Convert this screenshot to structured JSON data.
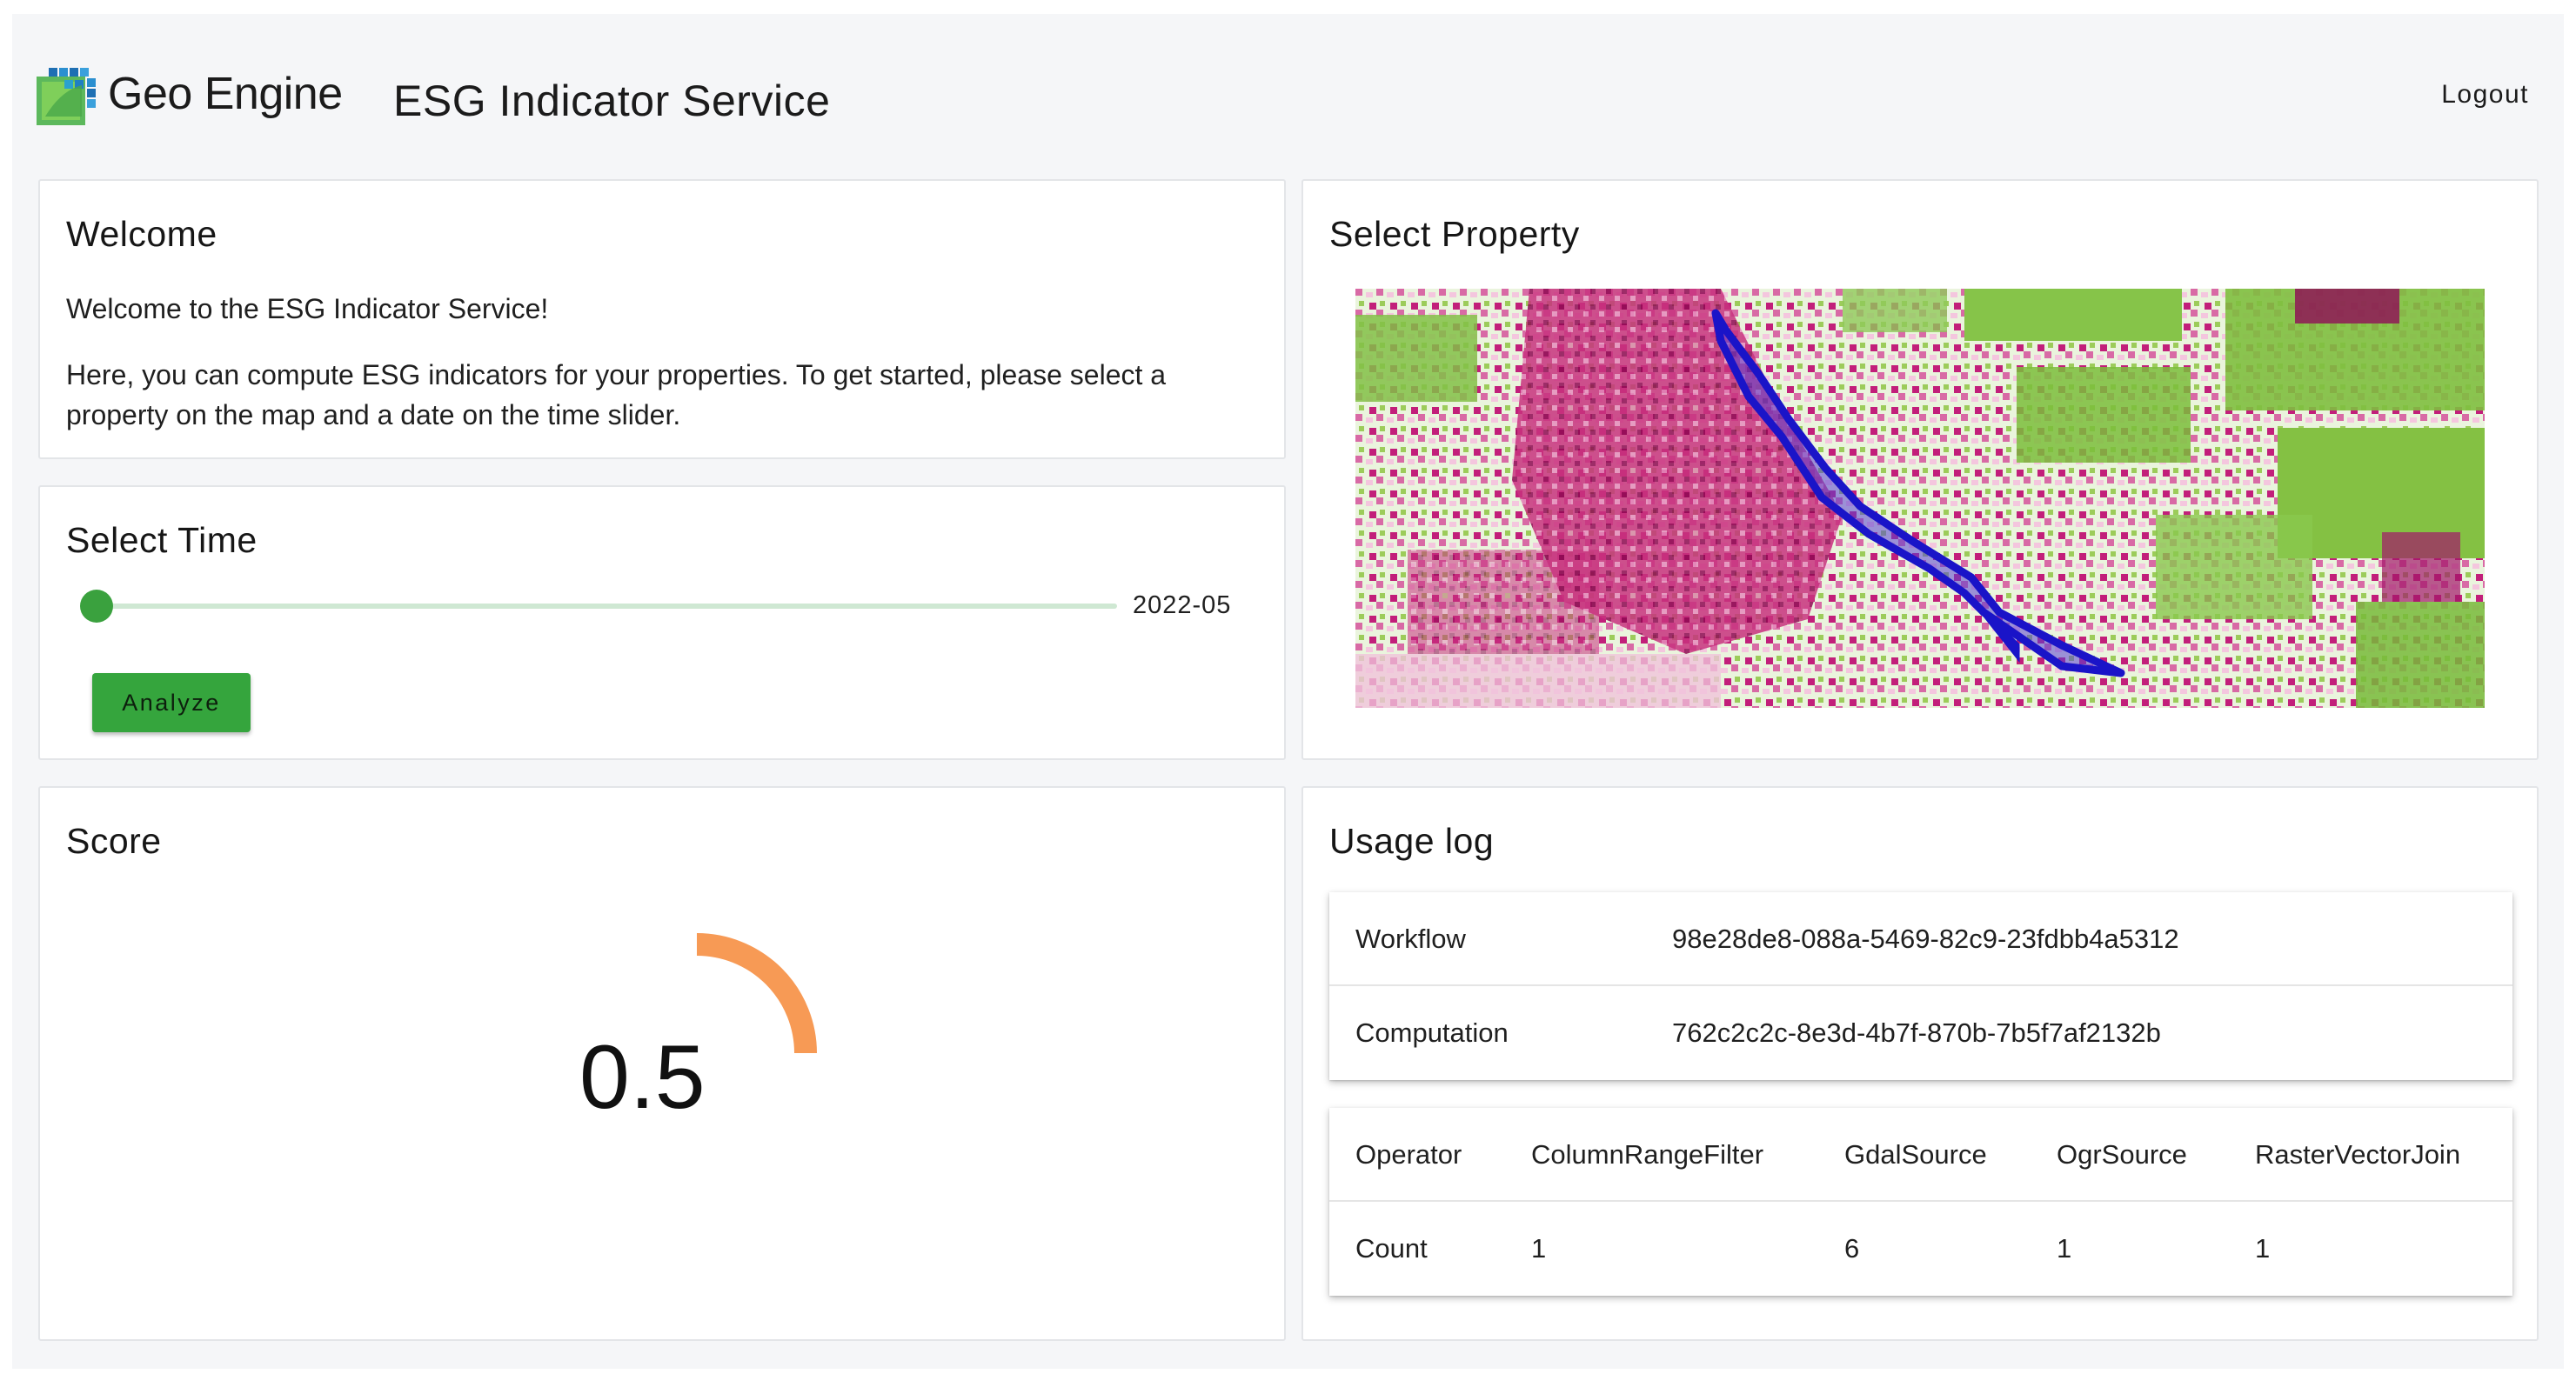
{
  "header": {
    "brand": "Geo Engine",
    "app_title": "ESG Indicator Service",
    "logout_label": "Logout",
    "logo_icon": "geo-engine-logo-icon"
  },
  "welcome": {
    "title": "Welcome",
    "line1": "Welcome to the ESG Indicator Service!",
    "line2a": "Here, you can compute ESG indicators for your properties. To get started, please select a",
    "line2b": "property on the map and a date on the time slider."
  },
  "select_time": {
    "title": "Select Time",
    "slider_value": "2022-05",
    "slider_position": 0,
    "analyze_label": "Analyze"
  },
  "score": {
    "title": "Score",
    "value": "0.5",
    "gauge_fraction": 0.5,
    "gauge_color": "#f79a55"
  },
  "select_property": {
    "title": "Select Property",
    "selection_color": "#1a14c8"
  },
  "usage_log": {
    "title": "Usage log",
    "ids": [
      {
        "label": "Workflow",
        "value": "98e28de8-088a-5469-82c9-23fdbb4a5312"
      },
      {
        "label": "Computation",
        "value": "762c2c2c-8e3d-4b7f-870b-7b5f7af2132b"
      }
    ],
    "operators": {
      "header": [
        "Operator",
        "ColumnRangeFilter",
        "GdalSource",
        "OgrSource",
        "RasterVectorJoin"
      ],
      "counts": [
        "Count",
        "1",
        "6",
        "1",
        "1"
      ]
    }
  },
  "colors": {
    "accent_green": "#35a53d",
    "background": "#f5f6f8"
  }
}
